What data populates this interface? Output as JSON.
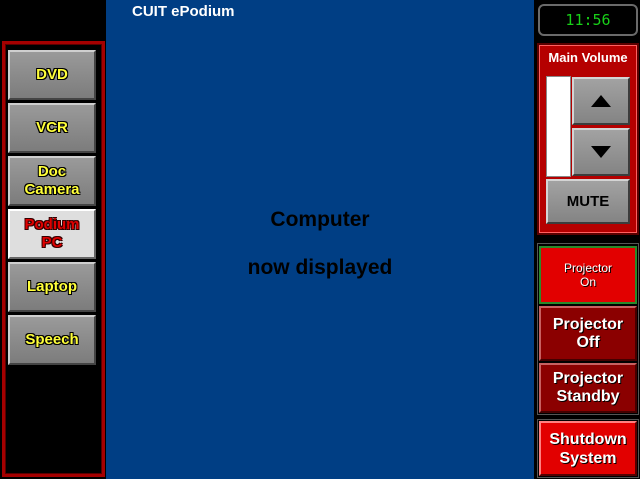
{
  "header": {
    "title": "CUIT ePodium"
  },
  "clock": {
    "time": "11:56"
  },
  "status": {
    "line1": "Computer",
    "line2": "now displayed"
  },
  "sources": [
    {
      "label": "DVD",
      "selected": false
    },
    {
      "label": "VCR",
      "selected": false
    },
    {
      "label": "Doc\nCamera",
      "selected": false
    },
    {
      "label": "Podium\nPC",
      "selected": true
    },
    {
      "label": "Laptop",
      "selected": false
    },
    {
      "label": "Speech",
      "selected": false
    }
  ],
  "volume": {
    "label": "Main Volume",
    "level": 0,
    "up_icon": "triangle-up-icon",
    "down_icon": "triangle-down-icon",
    "mute_label": "MUTE"
  },
  "projector": {
    "on_label": "Projector\nOn",
    "off_label": "Projector\nOff",
    "standby_label": "Projector\nStandby"
  },
  "system": {
    "shutdown_label": "Shutdown\nSystem"
  },
  "colors": {
    "main_bg": "#003e84",
    "panel_red": "#b50000",
    "active_red": "#e20000",
    "source_text": "#ffff3a",
    "clock_green": "#18d018"
  }
}
